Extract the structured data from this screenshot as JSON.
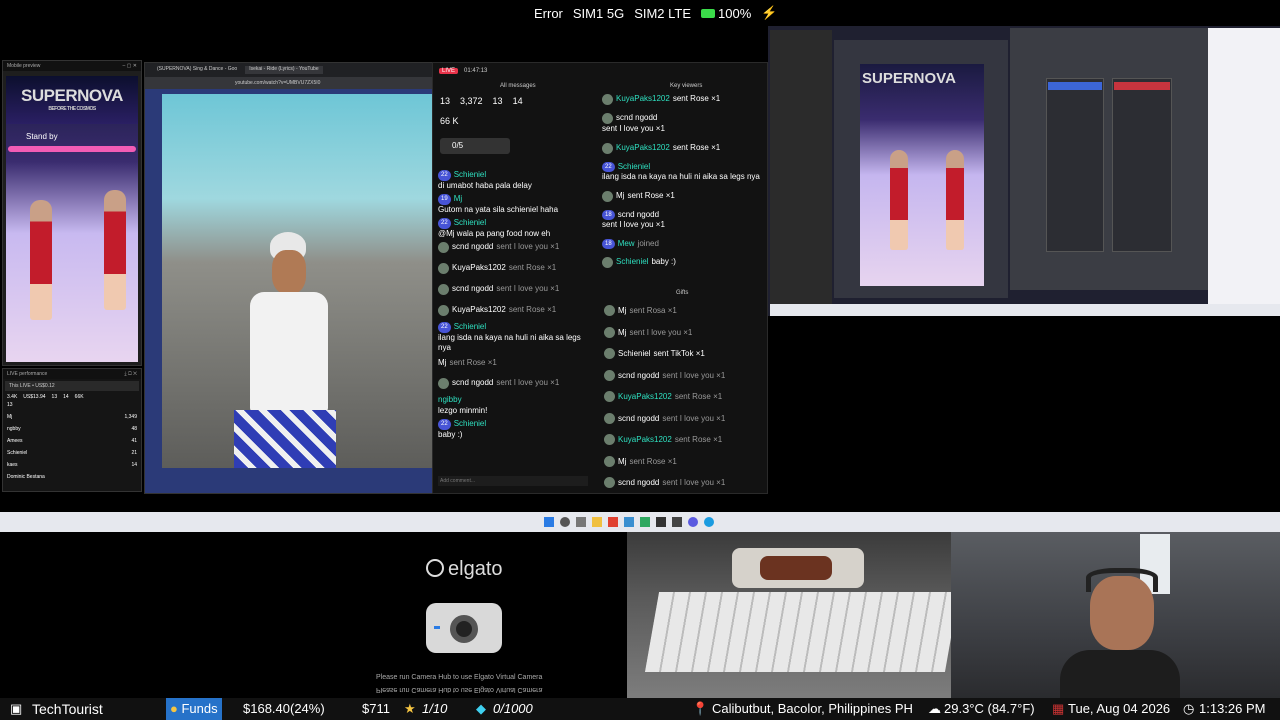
{
  "status": {
    "error": "Error",
    "sim1": "SIM1 5G",
    "sim2": "SIM2 LTE",
    "battery": "100%"
  },
  "mobile_preview": {
    "title": "Mobile preview",
    "banner": "SUPERNOVA",
    "subtitle": "BEFORE THE COSMOS",
    "stand_by": "Stand by"
  },
  "live_perf": {
    "title": "LIVE performance",
    "this_live": "This LIVE • US$0.12",
    "stats": [
      "3.4K",
      "US$13.94",
      "13",
      "14",
      "66K"
    ],
    "count": "13",
    "rows": [
      {
        "name": "Mj",
        "val": "1,349"
      },
      {
        "name": "ngbby",
        "val": "48"
      },
      {
        "name": "Amees",
        "val": "41"
      },
      {
        "name": "Schieniel",
        "val": "21"
      },
      {
        "name": "kaes",
        "val": "14"
      },
      {
        "name": "Dominic Bestana",
        "val": ""
      }
    ]
  },
  "browser": {
    "tab1": "(SUPERNOVA) Sing & Dance - Goo",
    "tab2": "Isekai - Ride (Lyrics) - YouTube",
    "url": "youtube.com/watch?v=UMBVU7ZX5I0"
  },
  "live_panel": {
    "time": "01:47:13",
    "all_messages": "All messages",
    "key_viewers": "Key viewers",
    "gifts": "Gifts",
    "stats": [
      "13",
      "3,372",
      "13",
      "14"
    ],
    "likes": "66 K",
    "goal": "0/5",
    "comment_placeholder": "Add comment..."
  },
  "all_messages": [
    {
      "name": "Schieniel",
      "text": "di umabot haba pala delay"
    },
    {
      "name": "Mj",
      "text": "Gutom na yata sila schieniel haha"
    },
    {
      "name": "Schieniel",
      "text": "@Mj wala pa pang food now eh"
    },
    {
      "name": "scnd ngodd",
      "text": "sent I love you ×1"
    },
    {
      "name": "KuyaPaks1202",
      "text": "sent Rose ×1"
    },
    {
      "name": "scnd ngodd",
      "text": "sent I love you ×1"
    },
    {
      "name": "KuyaPaks1202",
      "text": "sent Rose ×1"
    },
    {
      "name": "Schieniel",
      "text": "ilang isda na kaya na huli ni aika sa legs nya"
    },
    {
      "name": "Mj",
      "text": "sent Rose ×1"
    },
    {
      "name": "scnd ngodd",
      "text": "sent I love you ×1"
    },
    {
      "name": "ngibby",
      "text": "lezgo minmin!"
    },
    {
      "name": "Schieniel",
      "text": "baby :)"
    }
  ],
  "key_viewers": [
    {
      "name": "KuyaPaks1202",
      "text": "sent Rose ×1"
    },
    {
      "name": "scnd ngodd",
      "text": "sent I love you ×1"
    },
    {
      "name": "KuyaPaks1202",
      "text": "sent Rose ×1"
    },
    {
      "name": "Schieniel",
      "text": "ilang isda na kaya na huli ni aika sa legs nya"
    },
    {
      "name": "Mj",
      "text": "sent Rose ×1"
    },
    {
      "name": "scnd ngodd",
      "text": "sent I love you ×1"
    },
    {
      "name": "Mew",
      "text": "joined"
    },
    {
      "name": "Schieniel",
      "text": "baby :)"
    }
  ],
  "gifts": [
    {
      "name": "Mj",
      "text": "sent Rosa ×1"
    },
    {
      "name": "Mj",
      "text": "sent I love you ×1"
    },
    {
      "name": "Schieniel",
      "text": "sent TikTok ×1"
    },
    {
      "name": "scnd ngodd",
      "text": "sent I love you ×1"
    },
    {
      "name": "KuyaPaks1202",
      "text": "sent Rose ×1"
    },
    {
      "name": "scnd ngodd",
      "text": "sent I love you ×1"
    },
    {
      "name": "KuyaPaks1202",
      "text": "sent Rose ×1"
    },
    {
      "name": "Mj",
      "text": "sent Rose ×1"
    },
    {
      "name": "scnd ngodd",
      "text": "sent I love you ×1"
    }
  ],
  "camera": {
    "brand": "elgato",
    "message": "Please run Camera Hub to use Elgato Virtual Camera"
  },
  "bottom": {
    "channel": "TechTourist",
    "funds_label": "Funds",
    "funds_value": "$168.40(24%)",
    "amount": "$711",
    "rating": "1/10",
    "gems": "0/1000",
    "location": "Calibutbut, Bacolor, Philippines PH",
    "weather": "29.3°C (84.7°F)",
    "date": "Tue, Aug 04 2026",
    "time": "1:13:26 PM"
  }
}
